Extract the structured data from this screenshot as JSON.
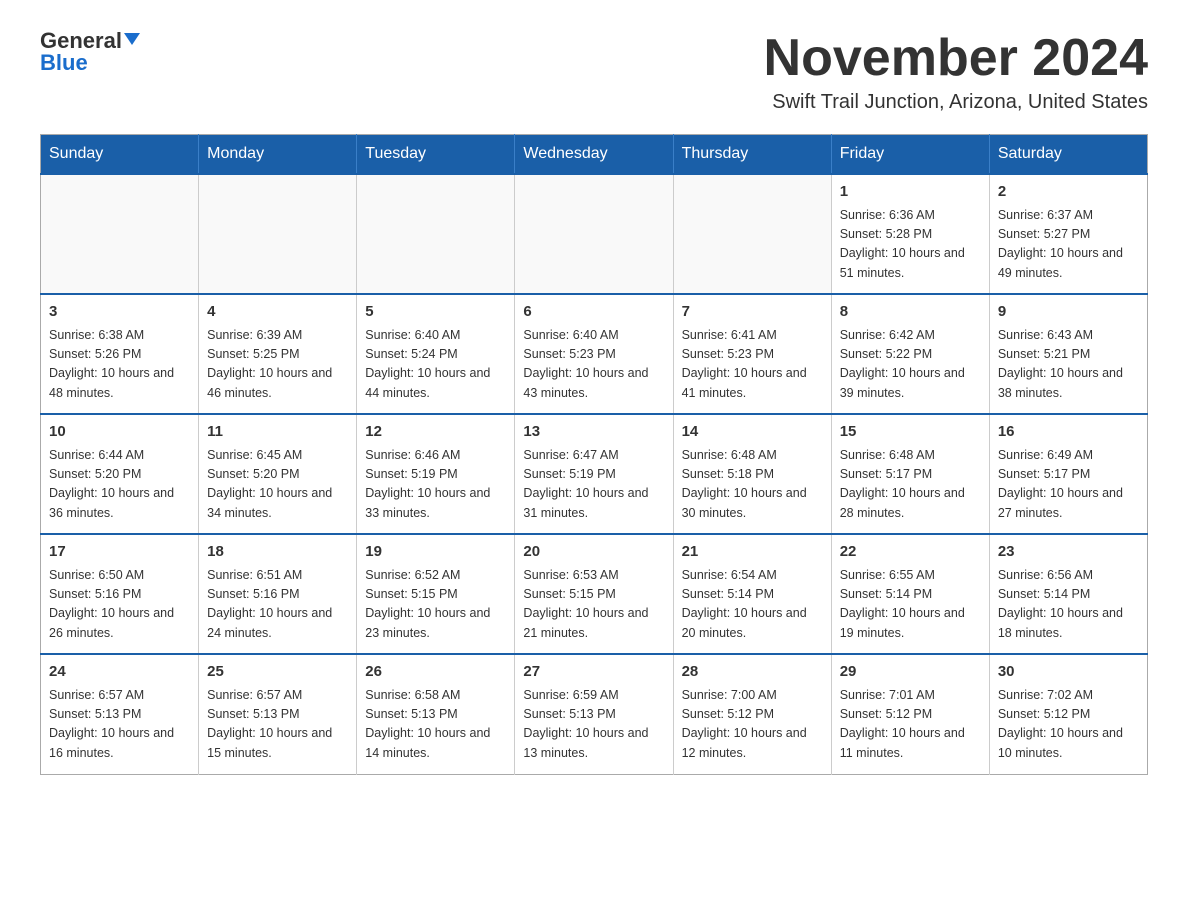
{
  "header": {
    "logo_line1": "General",
    "logo_line2": "Blue",
    "month_title": "November 2024",
    "location": "Swift Trail Junction, Arizona, United States"
  },
  "weekdays": [
    "Sunday",
    "Monday",
    "Tuesday",
    "Wednesday",
    "Thursday",
    "Friday",
    "Saturday"
  ],
  "weeks": [
    [
      {
        "day": "",
        "info": ""
      },
      {
        "day": "",
        "info": ""
      },
      {
        "day": "",
        "info": ""
      },
      {
        "day": "",
        "info": ""
      },
      {
        "day": "",
        "info": ""
      },
      {
        "day": "1",
        "info": "Sunrise: 6:36 AM\nSunset: 5:28 PM\nDaylight: 10 hours and 51 minutes."
      },
      {
        "day": "2",
        "info": "Sunrise: 6:37 AM\nSunset: 5:27 PM\nDaylight: 10 hours and 49 minutes."
      }
    ],
    [
      {
        "day": "3",
        "info": "Sunrise: 6:38 AM\nSunset: 5:26 PM\nDaylight: 10 hours and 48 minutes."
      },
      {
        "day": "4",
        "info": "Sunrise: 6:39 AM\nSunset: 5:25 PM\nDaylight: 10 hours and 46 minutes."
      },
      {
        "day": "5",
        "info": "Sunrise: 6:40 AM\nSunset: 5:24 PM\nDaylight: 10 hours and 44 minutes."
      },
      {
        "day": "6",
        "info": "Sunrise: 6:40 AM\nSunset: 5:23 PM\nDaylight: 10 hours and 43 minutes."
      },
      {
        "day": "7",
        "info": "Sunrise: 6:41 AM\nSunset: 5:23 PM\nDaylight: 10 hours and 41 minutes."
      },
      {
        "day": "8",
        "info": "Sunrise: 6:42 AM\nSunset: 5:22 PM\nDaylight: 10 hours and 39 minutes."
      },
      {
        "day": "9",
        "info": "Sunrise: 6:43 AM\nSunset: 5:21 PM\nDaylight: 10 hours and 38 minutes."
      }
    ],
    [
      {
        "day": "10",
        "info": "Sunrise: 6:44 AM\nSunset: 5:20 PM\nDaylight: 10 hours and 36 minutes."
      },
      {
        "day": "11",
        "info": "Sunrise: 6:45 AM\nSunset: 5:20 PM\nDaylight: 10 hours and 34 minutes."
      },
      {
        "day": "12",
        "info": "Sunrise: 6:46 AM\nSunset: 5:19 PM\nDaylight: 10 hours and 33 minutes."
      },
      {
        "day": "13",
        "info": "Sunrise: 6:47 AM\nSunset: 5:19 PM\nDaylight: 10 hours and 31 minutes."
      },
      {
        "day": "14",
        "info": "Sunrise: 6:48 AM\nSunset: 5:18 PM\nDaylight: 10 hours and 30 minutes."
      },
      {
        "day": "15",
        "info": "Sunrise: 6:48 AM\nSunset: 5:17 PM\nDaylight: 10 hours and 28 minutes."
      },
      {
        "day": "16",
        "info": "Sunrise: 6:49 AM\nSunset: 5:17 PM\nDaylight: 10 hours and 27 minutes."
      }
    ],
    [
      {
        "day": "17",
        "info": "Sunrise: 6:50 AM\nSunset: 5:16 PM\nDaylight: 10 hours and 26 minutes."
      },
      {
        "day": "18",
        "info": "Sunrise: 6:51 AM\nSunset: 5:16 PM\nDaylight: 10 hours and 24 minutes."
      },
      {
        "day": "19",
        "info": "Sunrise: 6:52 AM\nSunset: 5:15 PM\nDaylight: 10 hours and 23 minutes."
      },
      {
        "day": "20",
        "info": "Sunrise: 6:53 AM\nSunset: 5:15 PM\nDaylight: 10 hours and 21 minutes."
      },
      {
        "day": "21",
        "info": "Sunrise: 6:54 AM\nSunset: 5:14 PM\nDaylight: 10 hours and 20 minutes."
      },
      {
        "day": "22",
        "info": "Sunrise: 6:55 AM\nSunset: 5:14 PM\nDaylight: 10 hours and 19 minutes."
      },
      {
        "day": "23",
        "info": "Sunrise: 6:56 AM\nSunset: 5:14 PM\nDaylight: 10 hours and 18 minutes."
      }
    ],
    [
      {
        "day": "24",
        "info": "Sunrise: 6:57 AM\nSunset: 5:13 PM\nDaylight: 10 hours and 16 minutes."
      },
      {
        "day": "25",
        "info": "Sunrise: 6:57 AM\nSunset: 5:13 PM\nDaylight: 10 hours and 15 minutes."
      },
      {
        "day": "26",
        "info": "Sunrise: 6:58 AM\nSunset: 5:13 PM\nDaylight: 10 hours and 14 minutes."
      },
      {
        "day": "27",
        "info": "Sunrise: 6:59 AM\nSunset: 5:13 PM\nDaylight: 10 hours and 13 minutes."
      },
      {
        "day": "28",
        "info": "Sunrise: 7:00 AM\nSunset: 5:12 PM\nDaylight: 10 hours and 12 minutes."
      },
      {
        "day": "29",
        "info": "Sunrise: 7:01 AM\nSunset: 5:12 PM\nDaylight: 10 hours and 11 minutes."
      },
      {
        "day": "30",
        "info": "Sunrise: 7:02 AM\nSunset: 5:12 PM\nDaylight: 10 hours and 10 minutes."
      }
    ]
  ]
}
